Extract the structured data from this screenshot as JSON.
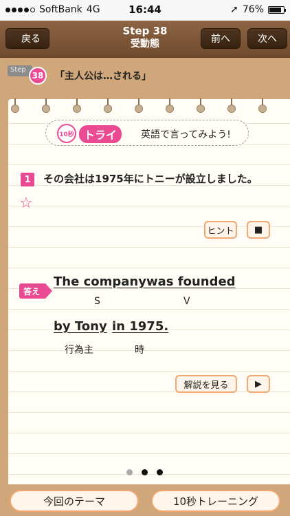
{
  "status_bar": {
    "carrier": "SoftBank",
    "network": "4G",
    "time": "16:44",
    "battery": "76%",
    "battery_level": 0.76
  },
  "nav": {
    "back_label": "戻る",
    "title": "Step 38",
    "subtitle": "受動態",
    "prev_label": "前へ",
    "next_label": "次へ"
  },
  "theme": {
    "step_badge": "Step",
    "step_number": "38",
    "text": "「主人公は…される」"
  },
  "try": {
    "seconds_badge": "10秒",
    "label": "トライ",
    "instruction": "英語で言ってみよう!"
  },
  "question": {
    "number": "1",
    "text": "その会社は1975年にトニーが設立しました。",
    "hint_label": "ヒント",
    "stop_label": "■"
  },
  "answer": {
    "tag": "答え",
    "line1": [
      {
        "text": "The company",
        "role": "S"
      },
      {
        "text": "was founded",
        "role": "V"
      }
    ],
    "line2": [
      {
        "text": "by Tony",
        "role": "行為主"
      },
      {
        "text": "in 1975.",
        "role": "時"
      }
    ],
    "explain_label": "解説を見る",
    "play_label": "▶"
  },
  "pager": {
    "current": 1,
    "total": 3
  },
  "bottom": {
    "theme_label": "今回のテーマ",
    "training_label": "10秒トレーニング"
  }
}
